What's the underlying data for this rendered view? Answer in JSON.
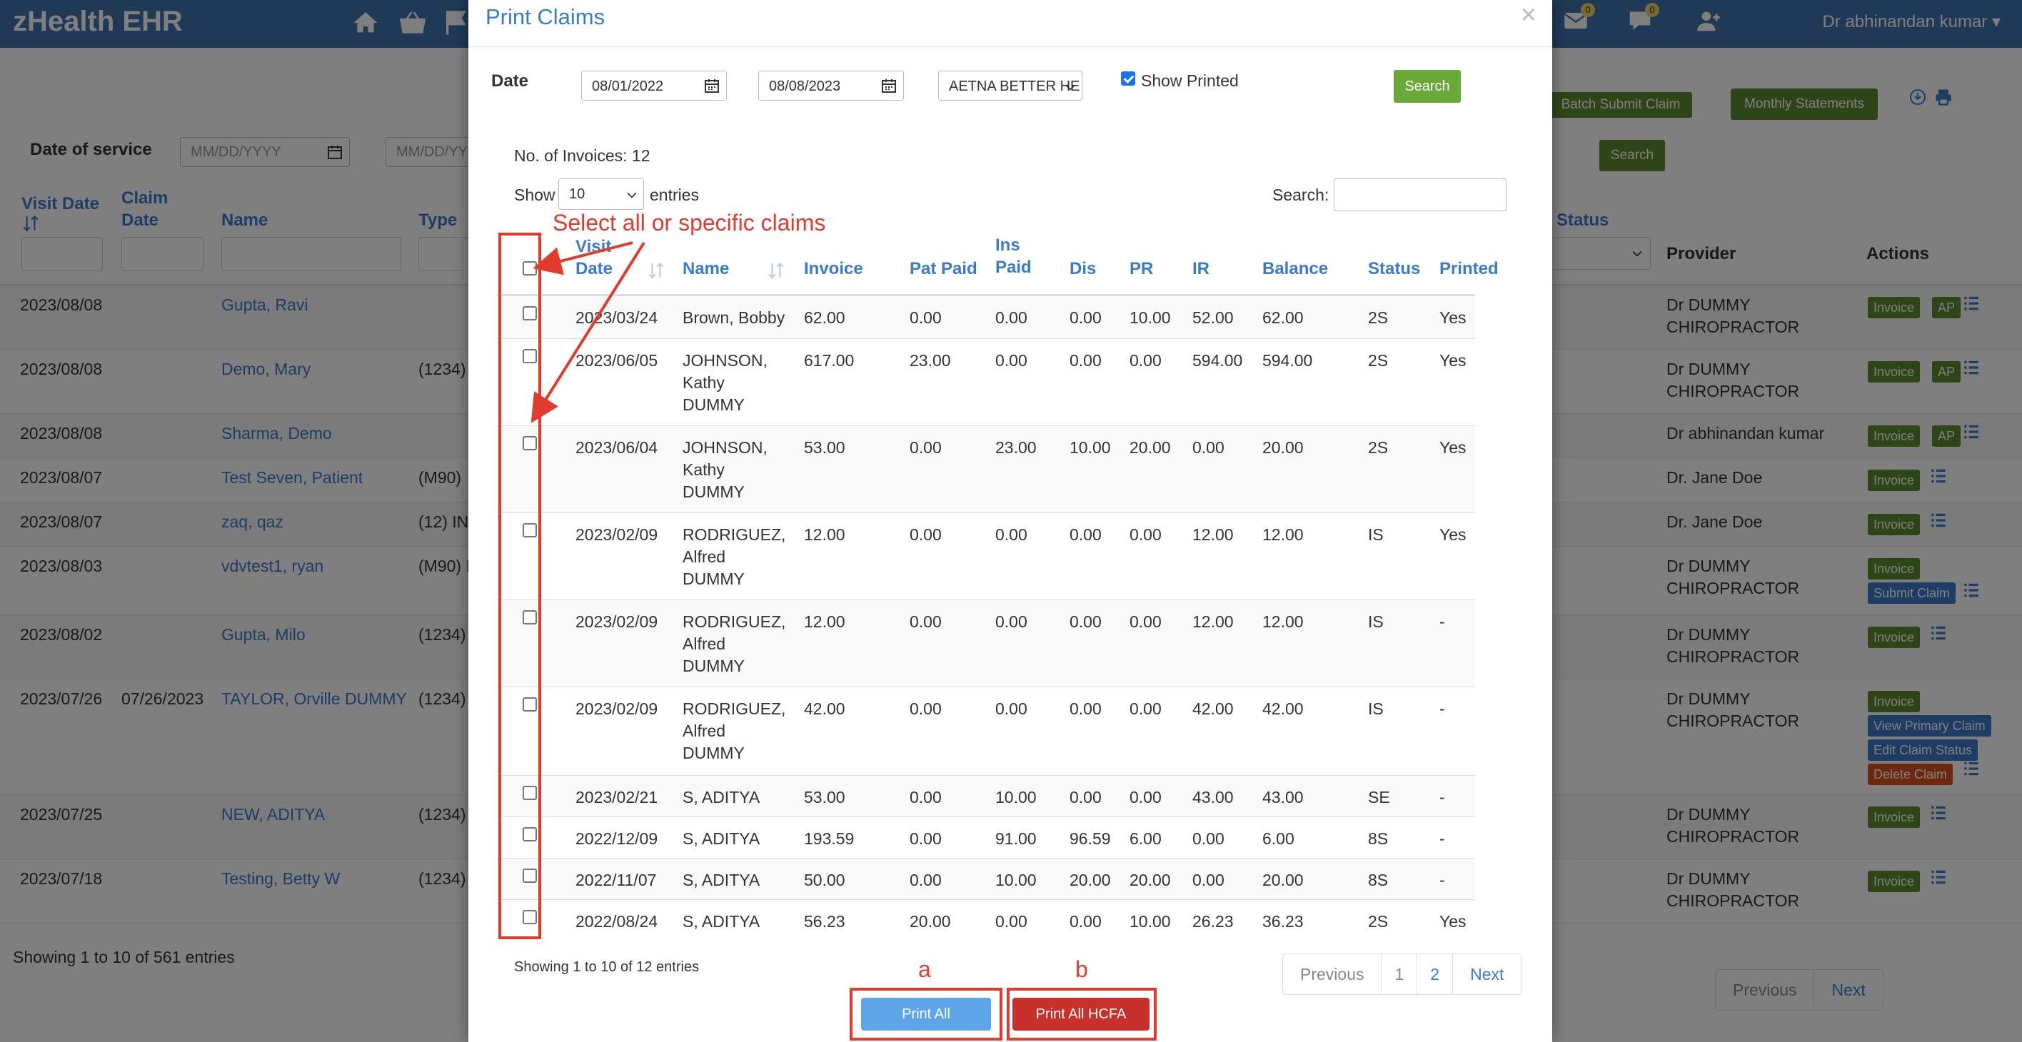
{
  "app": {
    "brand": "zHealth EHR",
    "user_name": "Dr abhinandan kumar",
    "badge_messages": "0",
    "badge_chat": "0"
  },
  "page": {
    "date_of_service_label": "Date of service",
    "date_from_placeholder": "MM/DD/YYYY",
    "date_to_placeholder": "MM/DD/YY",
    "batch_submit_label": "Batch Submit Claim",
    "monthly_statements_label": "Monthly Statements",
    "search_label": "Search",
    "columns": {
      "visit_date": "Visit Date",
      "claim_date": "Claim Date",
      "name": "Name",
      "type": "Type",
      "claim_status": "e Status",
      "provider": "Provider",
      "actions": "Actions"
    },
    "rows": [
      {
        "visit": "2023/08/08",
        "claim": "",
        "name": "Gupta, Ravi",
        "type": "",
        "provider": "Dr DUMMY CHIROPRACTOR",
        "actions": [
          "Invoice",
          "AP"
        ]
      },
      {
        "visit": "2023/08/08",
        "claim": "",
        "name": "Demo, Mary",
        "type": "(1234)",
        "provider": "Dr DUMMY CHIROPRACTOR",
        "actions": [
          "Invoice",
          "AP"
        ]
      },
      {
        "visit": "2023/08/08",
        "claim": "",
        "name": "Sharma, Demo",
        "type": "",
        "provider": "Dr abhinandan kumar",
        "actions": [
          "Invoice",
          "AP"
        ]
      },
      {
        "visit": "2023/08/07",
        "claim": "",
        "name": "Test Seven, Patient",
        "type": "(M90)",
        "provider": "Dr. Jane Doe",
        "actions": [
          "Invoice"
        ]
      },
      {
        "visit": "2023/08/07",
        "claim": "",
        "name": "zaq, qaz",
        "type": "(12) IN",
        "provider": "Dr. Jane Doe",
        "actions": [
          "Invoice"
        ]
      },
      {
        "visit": "2023/08/03",
        "claim": "",
        "name": "vdvtest1, ryan",
        "type": "(M90) I",
        "provider": "Dr DUMMY CHIROPRACTOR",
        "actions": [
          "Invoice",
          "Submit Claim"
        ]
      },
      {
        "visit": "2023/08/02",
        "claim": "",
        "name": "Gupta, Milo",
        "type": "(1234)",
        "provider": "Dr DUMMY CHIROPRACTOR",
        "actions": [
          "Invoice"
        ]
      },
      {
        "visit": "2023/07/26",
        "claim": "07/26/2023",
        "name": "TAYLOR, Orville DUMMY",
        "type": "(1234)",
        "provider": "Dr DUMMY CHIROPRACTOR",
        "actions": [
          "Invoice",
          "View Primary Claim",
          "Edit Claim Status",
          "Delete Claim"
        ]
      },
      {
        "visit": "2023/07/25",
        "claim": "",
        "name": "NEW, ADITYA",
        "type": "(1234)",
        "provider": "Dr DUMMY CHIROPRACTOR",
        "actions": [
          "Invoice"
        ]
      },
      {
        "visit": "2023/07/18",
        "claim": "",
        "name": "Testing, Betty W",
        "type": "(1234)",
        "provider": "Dr DUMMY CHIROPRACTOR",
        "actions": [
          "Invoice"
        ]
      }
    ],
    "showing": "Showing 1 to 10 of 561 entries",
    "previous": "Previous",
    "next": "Next"
  },
  "modal": {
    "title": "Print Claims",
    "close": "×",
    "date_label": "Date",
    "date_from": "08/01/2022",
    "date_to": "08/08/2023",
    "insurance": "AETNA BETTER HE",
    "show_printed_label": "Show Printed",
    "show_printed_checked": true,
    "search_button": "Search",
    "invoice_count": "No. of Invoices: 12",
    "show_label": "Show",
    "entries_value": "10",
    "entries_label": "entries",
    "search_label": "Search:",
    "columns": {
      "visit_date_1": "Visit",
      "visit_date_2": "Date",
      "name": "Name",
      "invoice": "Invoice",
      "pat_paid": "Pat Paid",
      "ins_paid_1": "Ins",
      "ins_paid_2": "Paid",
      "dis": "Dis",
      "pr": "PR",
      "ir": "IR",
      "balance": "Balance",
      "status": "Status",
      "printed": "Printed"
    },
    "rows": [
      {
        "date": "2023/03/24",
        "name": [
          "Brown, Bobby"
        ],
        "invoice": "62.00",
        "pat_paid": "0.00",
        "ins_paid": "0.00",
        "dis": "0.00",
        "pr": "10.00",
        "ir": "52.00",
        "balance": "62.00",
        "status": "2S",
        "printed": "Yes"
      },
      {
        "date": "2023/06/05",
        "name": [
          "JOHNSON,",
          "Kathy",
          "DUMMY"
        ],
        "invoice": "617.00",
        "pat_paid": "23.00",
        "ins_paid": "0.00",
        "dis": "0.00",
        "pr": "0.00",
        "ir": "594.00",
        "balance": "594.00",
        "status": "2S",
        "printed": "Yes"
      },
      {
        "date": "2023/06/04",
        "name": [
          "JOHNSON,",
          "Kathy",
          "DUMMY"
        ],
        "invoice": "53.00",
        "pat_paid": "0.00",
        "ins_paid": "23.00",
        "dis": "10.00",
        "pr": "20.00",
        "ir": "0.00",
        "balance": "20.00",
        "status": "2S",
        "printed": "Yes"
      },
      {
        "date": "2023/02/09",
        "name": [
          "RODRIGUEZ,",
          "Alfred",
          "DUMMY"
        ],
        "invoice": "12.00",
        "pat_paid": "0.00",
        "ins_paid": "0.00",
        "dis": "0.00",
        "pr": "0.00",
        "ir": "12.00",
        "balance": "12.00",
        "status": "IS",
        "printed": "Yes"
      },
      {
        "date": "2023/02/09",
        "name": [
          "RODRIGUEZ,",
          "Alfred",
          "DUMMY"
        ],
        "invoice": "12.00",
        "pat_paid": "0.00",
        "ins_paid": "0.00",
        "dis": "0.00",
        "pr": "0.00",
        "ir": "12.00",
        "balance": "12.00",
        "status": "IS",
        "printed": "-"
      },
      {
        "date": "2023/02/09",
        "name": [
          "RODRIGUEZ,",
          "Alfred",
          "DUMMY"
        ],
        "invoice": "42.00",
        "pat_paid": "0.00",
        "ins_paid": "0.00",
        "dis": "0.00",
        "pr": "0.00",
        "ir": "42.00",
        "balance": "42.00",
        "status": "IS",
        "printed": "-"
      },
      {
        "date": "2023/02/21",
        "name": [
          "S, ADITYA"
        ],
        "invoice": "53.00",
        "pat_paid": "0.00",
        "ins_paid": "10.00",
        "dis": "0.00",
        "pr": "0.00",
        "ir": "43.00",
        "balance": "43.00",
        "status": "SE",
        "printed": "-"
      },
      {
        "date": "2022/12/09",
        "name": [
          "S, ADITYA"
        ],
        "invoice": "193.59",
        "pat_paid": "0.00",
        "ins_paid": "91.00",
        "dis": "96.59",
        "pr": "6.00",
        "ir": "0.00",
        "balance": "6.00",
        "status": "8S",
        "printed": "-"
      },
      {
        "date": "2022/11/07",
        "name": [
          "S, ADITYA"
        ],
        "invoice": "50.00",
        "pat_paid": "0.00",
        "ins_paid": "10.00",
        "dis": "20.00",
        "pr": "20.00",
        "ir": "0.00",
        "balance": "20.00",
        "status": "8S",
        "printed": "-"
      },
      {
        "date": "2022/08/24",
        "name": [
          "S, ADITYA"
        ],
        "invoice": "56.23",
        "pat_paid": "20.00",
        "ins_paid": "0.00",
        "dis": "0.00",
        "pr": "10.00",
        "ir": "26.23",
        "balance": "36.23",
        "status": "2S",
        "printed": "Yes"
      }
    ],
    "showing": "Showing 1 to 10 of 12 entries",
    "pager": [
      "Previous",
      "1",
      "2",
      "Next"
    ],
    "print_all": "Print All",
    "print_all_hcfa": "Print All HCFA"
  },
  "annotations": {
    "select_text": "Select all or specific claims",
    "label_a": "a",
    "label_b": "b"
  },
  "colors": {
    "nav": "#3f72af",
    "link": "#3a7bc8",
    "green": "#5d8a2e",
    "search_green": "#6aa838",
    "red_button": "#c9302c",
    "annotation": "#e23b2e"
  }
}
